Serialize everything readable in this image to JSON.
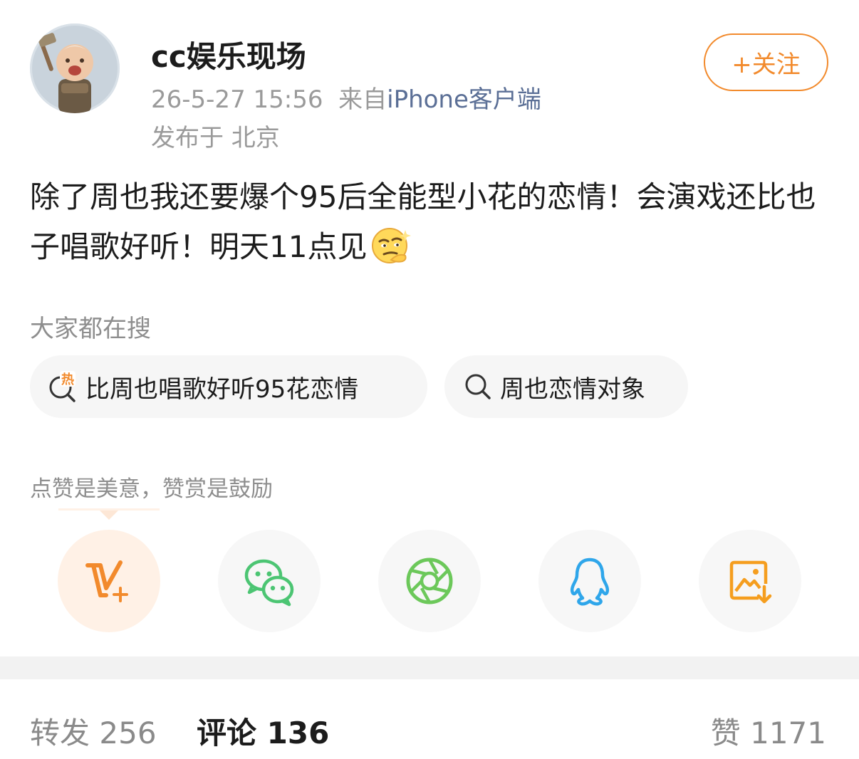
{
  "header": {
    "username": "cc娱乐现场",
    "timestamp": "26-5-27 15:56",
    "from_prefix": "来自",
    "source": "iPhone客户端",
    "location": "发布于 北京",
    "follow_label": "+关注",
    "avatar_icon": "avatar-image"
  },
  "post": {
    "text": "除了周也我还要爆个95后全能型小花的恋情！会演戏还比也子唱歌好听！明天11点见",
    "emoji_icon": "smirk-emoji-icon"
  },
  "hot_search": {
    "title": "大家都在搜",
    "chips": [
      {
        "label": "比周也唱歌好听95花恋情",
        "icon": "hot-search-icon"
      },
      {
        "label": "周也恋情对象",
        "icon": "search-icon"
      }
    ]
  },
  "share": {
    "title": "点赞是美意，赞赏是鼓励",
    "targets": [
      {
        "icon": "weibo-v-plus-icon",
        "color": "#f28a2c"
      },
      {
        "icon": "wechat-icon",
        "color": "#4cc573"
      },
      {
        "icon": "moments-icon",
        "color": "#6cc85a"
      },
      {
        "icon": "qq-icon",
        "color": "#2fa6ea"
      },
      {
        "icon": "save-image-icon",
        "color": "#f59e1f"
      }
    ]
  },
  "tabs": {
    "repost_label": "转发",
    "repost_count": "256",
    "comment_label": "评论",
    "comment_count": "136",
    "like_label": "赞",
    "like_count": "1171"
  },
  "colors": {
    "accent": "#f28a2c",
    "link": "#5b6f96",
    "muted": "#9a9a9a"
  }
}
